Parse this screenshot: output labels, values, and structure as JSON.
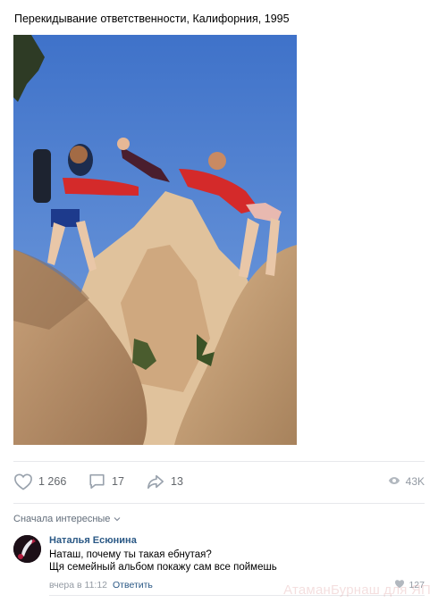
{
  "post": {
    "text": "Перекидывание ответственности, Калифорния, 1995",
    "image_alt": "photo"
  },
  "actions": {
    "likes": "1 266",
    "comments": "17",
    "shares": "13",
    "views": "43K"
  },
  "comments_section": {
    "sort_label": "Сначала интересные"
  },
  "comment": {
    "author": "Наталья Есюнина",
    "line1": "Наташ, почему ты такая ебнутая?",
    "line2": "Щя семейный альбом покажу сам все поймешь",
    "time": "вчера в 11:12",
    "reply_label": "Ответить",
    "likes": "127"
  },
  "watermark": "АтаманБурнаш для ЯП",
  "colors": {
    "link": "#2a5885",
    "muted": "#939aa3",
    "divider": "#e7e8ec"
  }
}
